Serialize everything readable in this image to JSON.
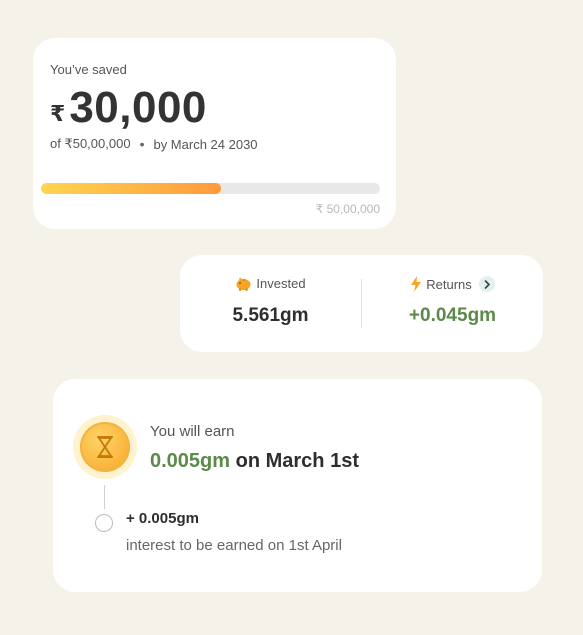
{
  "savings": {
    "label": "You’ve saved",
    "currency_symbol": "₹",
    "amount": "30,000",
    "of_text": "of ₹50,00,000",
    "separator": "•",
    "by_text": "by March 24 2030",
    "progress_fraction": 0.53,
    "target_label": "₹ 50,00,000"
  },
  "stats": {
    "invested_label": "Invested",
    "invested_value": "5.561gm",
    "returns_label": "Returns",
    "returns_value": "+0.045gm"
  },
  "earn": {
    "label": "You will earn",
    "amount": "0.005gm",
    "date_text": " on March 1st",
    "step_amount": "+ 0.005gm",
    "step_desc": "interest to be earned on 1st April"
  },
  "colors": {
    "background": "#f5f2ea",
    "accent_green": "#5b8a4a",
    "progress_start": "#ffd54f",
    "progress_end": "#ff9a3c"
  },
  "icons": {
    "invested": "piggy-bank-icon",
    "returns": "lightning-icon",
    "returns_action": "chevron-right-icon",
    "earn": "hourglass-coin-icon"
  }
}
